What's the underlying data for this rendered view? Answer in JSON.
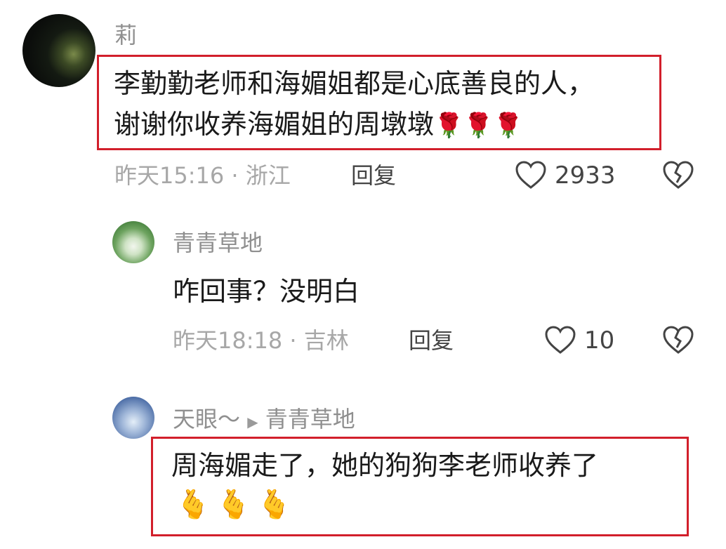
{
  "comments": [
    {
      "name": "莉",
      "text_line1": "李勤勤老师和海媚姐都是心底善良的人，",
      "text_line2": "谢谢你收养海媚姐的周墩墩",
      "emojis": "🌹🌹🌹",
      "meta": "昨天15:16 · 浙江",
      "reply_label": "回复",
      "like_count": "2933"
    },
    {
      "name": "青青草地",
      "text": "咋回事？没明白",
      "meta": "昨天18:18 · 吉林",
      "reply_label": "回复",
      "like_count": "10"
    },
    {
      "name": "天眼～",
      "reply_to": "青青草地",
      "text": "周海媚走了，她的狗狗李老师收养了",
      "emojis": "🫰🫰🫰"
    }
  ],
  "colors": {
    "highlight": "#d21f2b"
  }
}
